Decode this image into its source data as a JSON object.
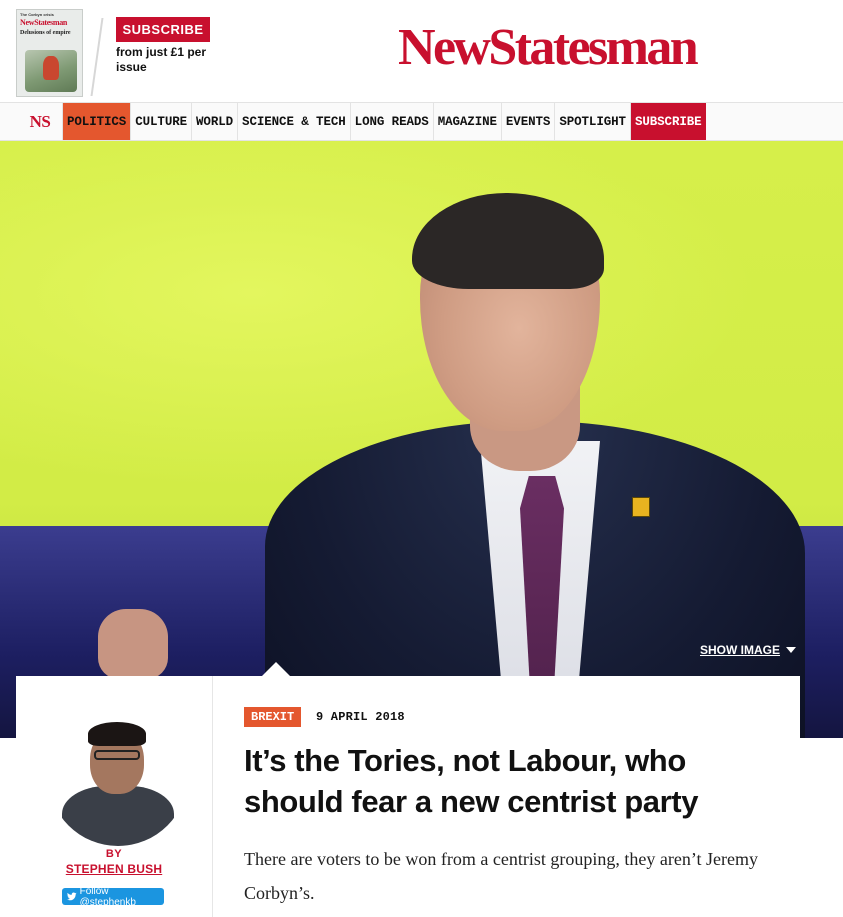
{
  "masthead": {
    "cover": {
      "kicker": "The Corbyn crisis",
      "logo": "NewStatesman",
      "headline": "Delusions of empire"
    },
    "subscribe_label": "SUBSCRIBE",
    "subscribe_tagline": "from just £1 per issue",
    "logo": "NewStatesman"
  },
  "nav": {
    "home_label": "NS",
    "items": [
      {
        "label": "POLITICS"
      },
      {
        "label": "CULTURE"
      },
      {
        "label": "WORLD"
      },
      {
        "label": "SCIENCE & TECH"
      },
      {
        "label": "LONG READS"
      },
      {
        "label": "MAGAZINE"
      },
      {
        "label": "EVENTS"
      },
      {
        "label": "SPOTLIGHT"
      },
      {
        "label": "SUBSCRIBE"
      }
    ],
    "active_item": "POLITICS"
  },
  "hero": {
    "show_image_label": "SHOW IMAGE",
    "show_image_icon": "caret-down-icon"
  },
  "article": {
    "author": {
      "by_label": "BY",
      "name": "STEPHEN BUSH",
      "follow_label": "Follow @stephenkb",
      "follow_icon": "twitter-bird-icon"
    },
    "tag": "BREXIT",
    "date": "9 APRIL 2018",
    "headline": "It’s the Tories, not Labour, who should fear a new centrist party",
    "standfirst": "There are voters to be won from a centrist grouping, they aren’t Jeremy Corbyn’s."
  },
  "colors": {
    "brand_red": "#c8102e",
    "section_orange": "#e4572e",
    "twitter_blue": "#1b95e0",
    "hero_background": "#d6ef4a"
  }
}
